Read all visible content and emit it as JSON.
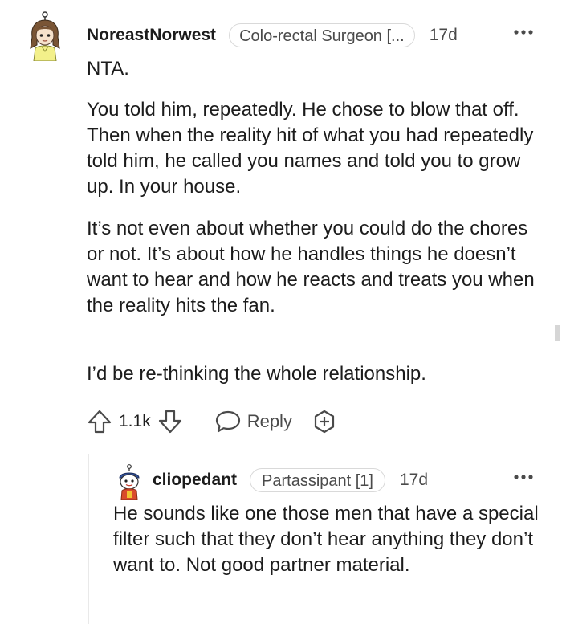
{
  "comment": {
    "username": "NoreastNorwest",
    "flair": "Colo-rectal Surgeon [...",
    "timestamp": "17d",
    "more_icon": "ellipsis-icon",
    "paragraphs": [
      "NTA.",
      "You told him, repeatedly. He chose to blow that off. Then when the reality hit of what you had repeatedly told him, he called you names and told you to grow up. In your house.",
      "It’s not even about whether you could do the chores or not. It’s about how he handles things he doesn’t want to hear and how he reacts and treats you when the reality hits the fan.",
      "I’d be re-thinking the whole relationship."
    ],
    "vote_count": "1.1k",
    "reply_label": "Reply",
    "icons": {
      "upvote": "upvote-arrow-icon",
      "downvote": "downvote-arrow-icon",
      "reply": "speech-bubble-icon",
      "award": "award-plus-icon"
    }
  },
  "reply": {
    "username": "cliopedant",
    "flair": "Partassipant [1]",
    "timestamp": "17d",
    "more_icon": "ellipsis-icon",
    "body": "He sounds like one those men that have a special filter such that they don’t hear anything they don’t want to. Not good partner material."
  },
  "colors": {
    "text": "#1c1c1c",
    "meta": "#4a4a4a",
    "border": "#d9d9d9",
    "thread_line": "#e9e9e9"
  }
}
